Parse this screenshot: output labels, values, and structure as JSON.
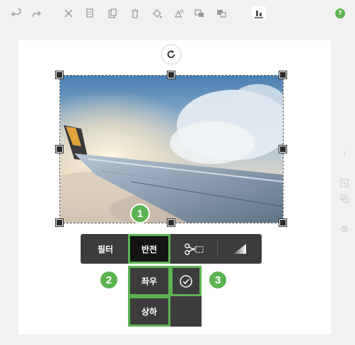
{
  "toolbar": {
    "tools": [
      {
        "icon": "undo-icon"
      },
      {
        "icon": "redo-icon"
      },
      {
        "icon": "cut-icon"
      },
      {
        "icon": "copy-icon"
      },
      {
        "icon": "paste-icon"
      },
      {
        "icon": "delete-icon"
      },
      {
        "icon": "fill-icon"
      },
      {
        "icon": "shape-icon"
      },
      {
        "icon": "bring-forward-icon"
      },
      {
        "icon": "send-backward-icon"
      },
      {
        "icon": "align-bottom-icon",
        "active": true
      }
    ],
    "help_label": "?"
  },
  "image_menu": {
    "filter_label": "필터",
    "flip_label": "반전",
    "crop_icon": "crop-icon",
    "adjust_icon": "gradient-icon"
  },
  "flip_submenu": {
    "horizontal_label": "좌우",
    "vertical_label": "상하",
    "confirm_icon": "check-circle-icon"
  },
  "steps": {
    "step1": "1",
    "step2": "2",
    "step3": "3"
  },
  "colors": {
    "accent_green": "#5bb451",
    "menu_dark": "#3c3c3c",
    "menu_selected": "#141414"
  }
}
